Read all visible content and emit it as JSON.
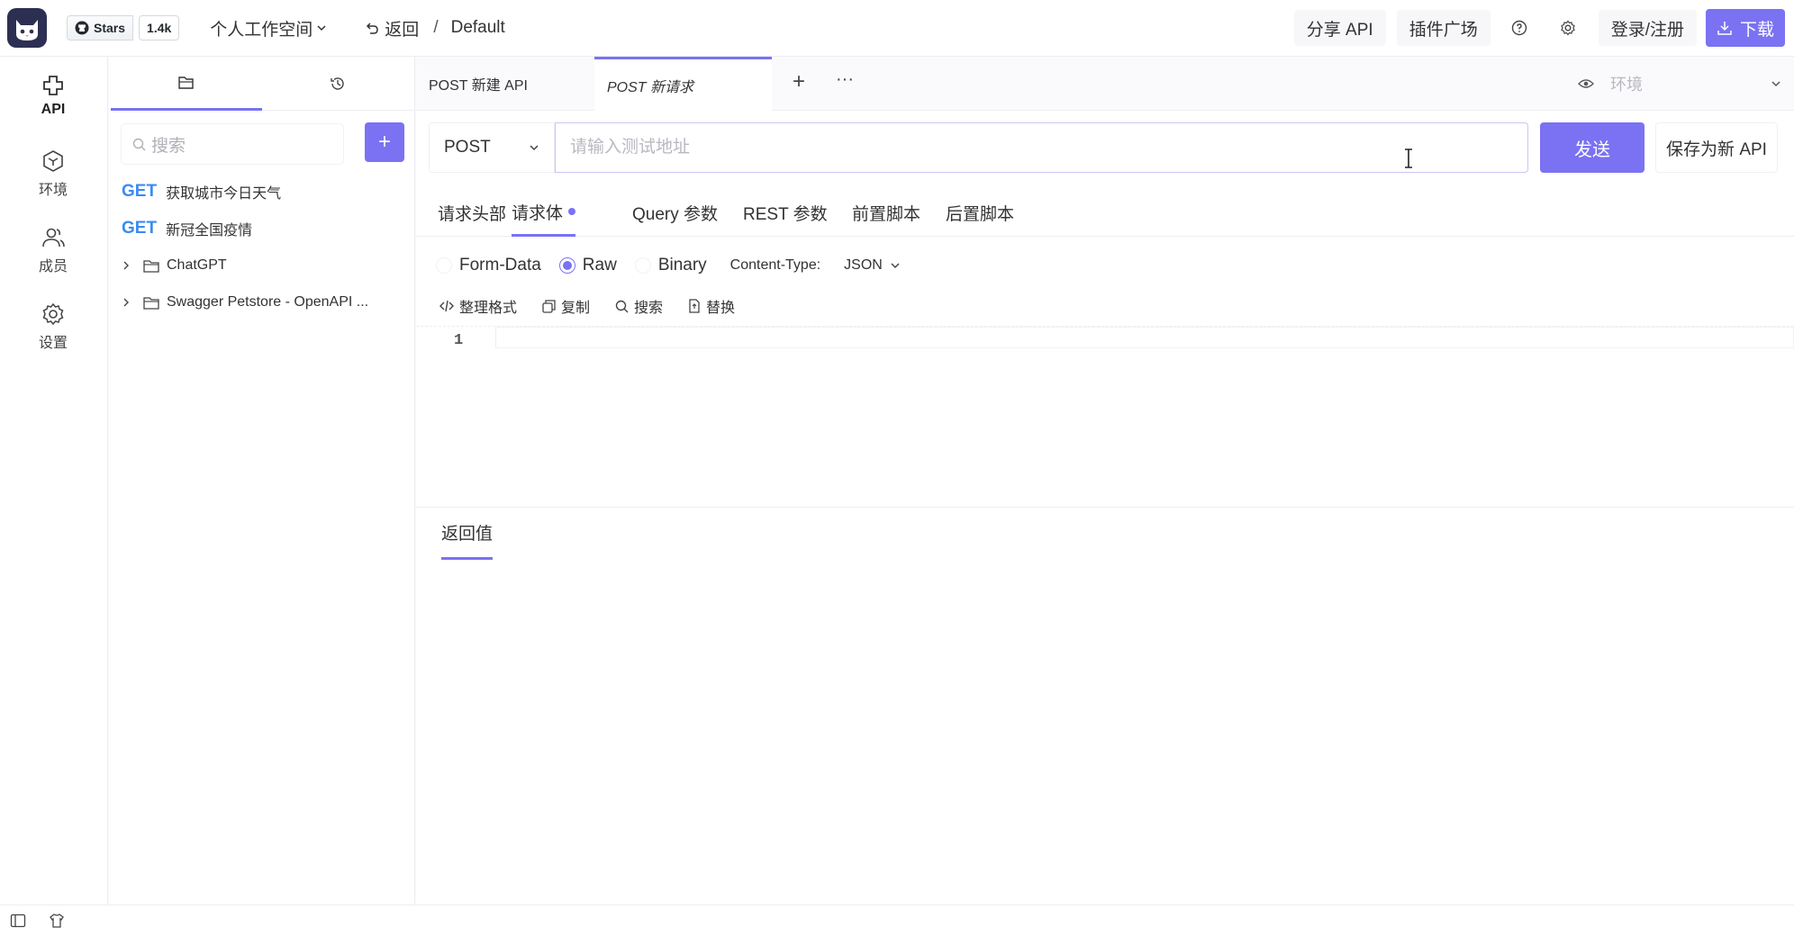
{
  "github": {
    "stars_label": "Stars",
    "stars_count": "1.4k"
  },
  "topbar": {
    "workspace": "个人工作空间",
    "back_label": "返回",
    "separator": "/",
    "breadcrumb": "Default",
    "share_label": "分享 API",
    "plugins_label": "插件广场",
    "login_label": "登录/注册",
    "download_label": "下载"
  },
  "rail": {
    "items": [
      {
        "label": "API",
        "icon": "api-icon"
      },
      {
        "label": "环境",
        "icon": "cube-icon"
      },
      {
        "label": "成员",
        "icon": "users-icon"
      },
      {
        "label": "设置",
        "icon": "gear-icon"
      }
    ]
  },
  "sidebar": {
    "search_placeholder": "搜索",
    "apis": [
      {
        "method": "GET",
        "name": "获取城市今日天气"
      },
      {
        "method": "GET",
        "name": "新冠全国疫情"
      }
    ],
    "folders": [
      {
        "name": "ChatGPT"
      },
      {
        "name": "Swagger Petstore - OpenAPI ..."
      }
    ]
  },
  "tabs": [
    {
      "label": "POST 新建 API"
    },
    {
      "label": "POST 新请求"
    }
  ],
  "env": {
    "label": "环境"
  },
  "request": {
    "method": "POST",
    "url_placeholder": "请输入测试地址",
    "send_label": "发送",
    "save_label": "保存为新 API"
  },
  "subtabs": [
    "请求头部",
    "请求体",
    "Query 参数",
    "REST 参数",
    "前置脚本",
    "后置脚本"
  ],
  "body_options": {
    "types": [
      "Form-Data",
      "Raw",
      "Binary"
    ],
    "selected": "Raw",
    "content_type_label": "Content-Type:",
    "content_type_value": "JSON"
  },
  "tools": [
    "整理格式",
    "复制",
    "搜索",
    "替换"
  ],
  "editor": {
    "line_number": "1"
  },
  "response": {
    "tab_label": "返回值"
  },
  "colors": {
    "accent": "#7a72f2",
    "method_get": "#3b8bf0"
  }
}
